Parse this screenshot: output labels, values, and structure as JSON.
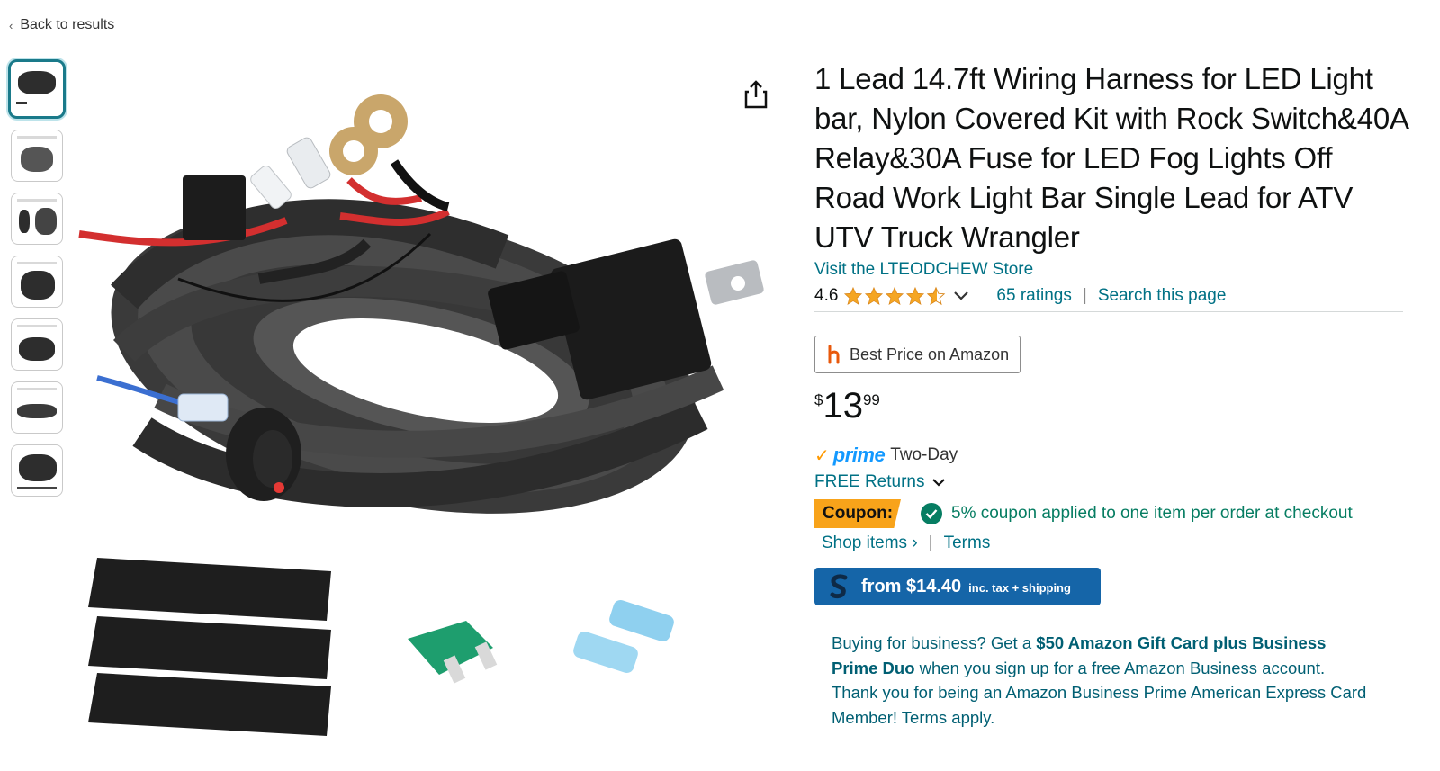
{
  "nav": {
    "back_label": "Back to results"
  },
  "gallery": {
    "thumbnail_count": 7
  },
  "product": {
    "title": "1 Lead 14.7ft Wiring Harness for LED Light bar, Nylon Covered Kit with Rock Switch&40A Relay&30A Fuse for LED Fog Lights Off Road Work Light Bar Single Lead for ATV UTV Truck Wrangler",
    "store_link": "Visit the LTEODCHEW Store",
    "rating_value": "4.6",
    "rating_fraction": 0.92,
    "ratings_count": "65 ratings",
    "search_page": "Search this page",
    "separator": "|"
  },
  "best_price": {
    "label": "Best Price on Amazon"
  },
  "price": {
    "symbol": "$",
    "whole": "13",
    "fraction": "99"
  },
  "delivery": {
    "prime": "prime",
    "two_day": "Two-Day",
    "returns": "FREE Returns"
  },
  "coupon": {
    "tag": "Coupon:",
    "text": "5% coupon applied to one item per order at checkout",
    "shop_items": "Shop items ›",
    "separator": "|",
    "terms": "Terms"
  },
  "shopping_button": {
    "from": "from $14.40",
    "tax_note": "inc. tax + shipping"
  },
  "business_offer": {
    "part1": "Buying for business? Get a ",
    "bold": "$50 Amazon Gift Card plus Business Prime Duo",
    "part2": " when you sign up for a free Amazon Business account. Thank you for being an Amazon Business Prime American Express Card Member! Terms apply."
  },
  "colors": {
    "link": "#007185",
    "coupon_tag": "#f8a31a",
    "success": "#067d62",
    "button": "#1565a8",
    "prime": "#1399ff",
    "star": "#f5a623"
  }
}
